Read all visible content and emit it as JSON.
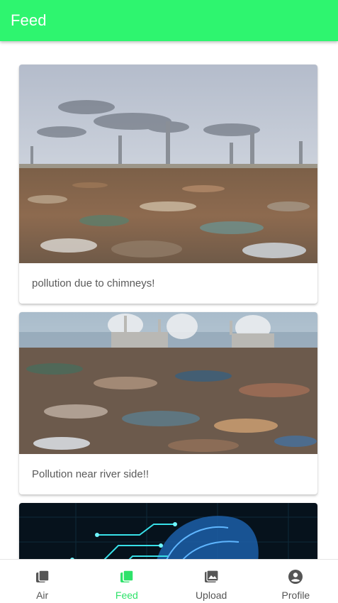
{
  "app_bar": {
    "title": "Feed",
    "color": "#2ef56f"
  },
  "feed": {
    "posts": [
      {
        "caption": "pollution due to chimneys!",
        "image": "landfill-with-chimneys-photo"
      },
      {
        "caption": "Pollution near river side!!",
        "image": "landfill-near-river-photo"
      },
      {
        "caption": "",
        "image": "digital-brain-circuit-photo"
      }
    ]
  },
  "bottom_nav": {
    "active": "Feed",
    "active_color": "#2ee26a",
    "items": [
      {
        "label": "Air",
        "icon": "stacked-squares-icon"
      },
      {
        "label": "Feed",
        "icon": "stacked-squares-icon"
      },
      {
        "label": "Upload",
        "icon": "image-icon"
      },
      {
        "label": "Profile",
        "icon": "account-circle-icon"
      }
    ]
  }
}
